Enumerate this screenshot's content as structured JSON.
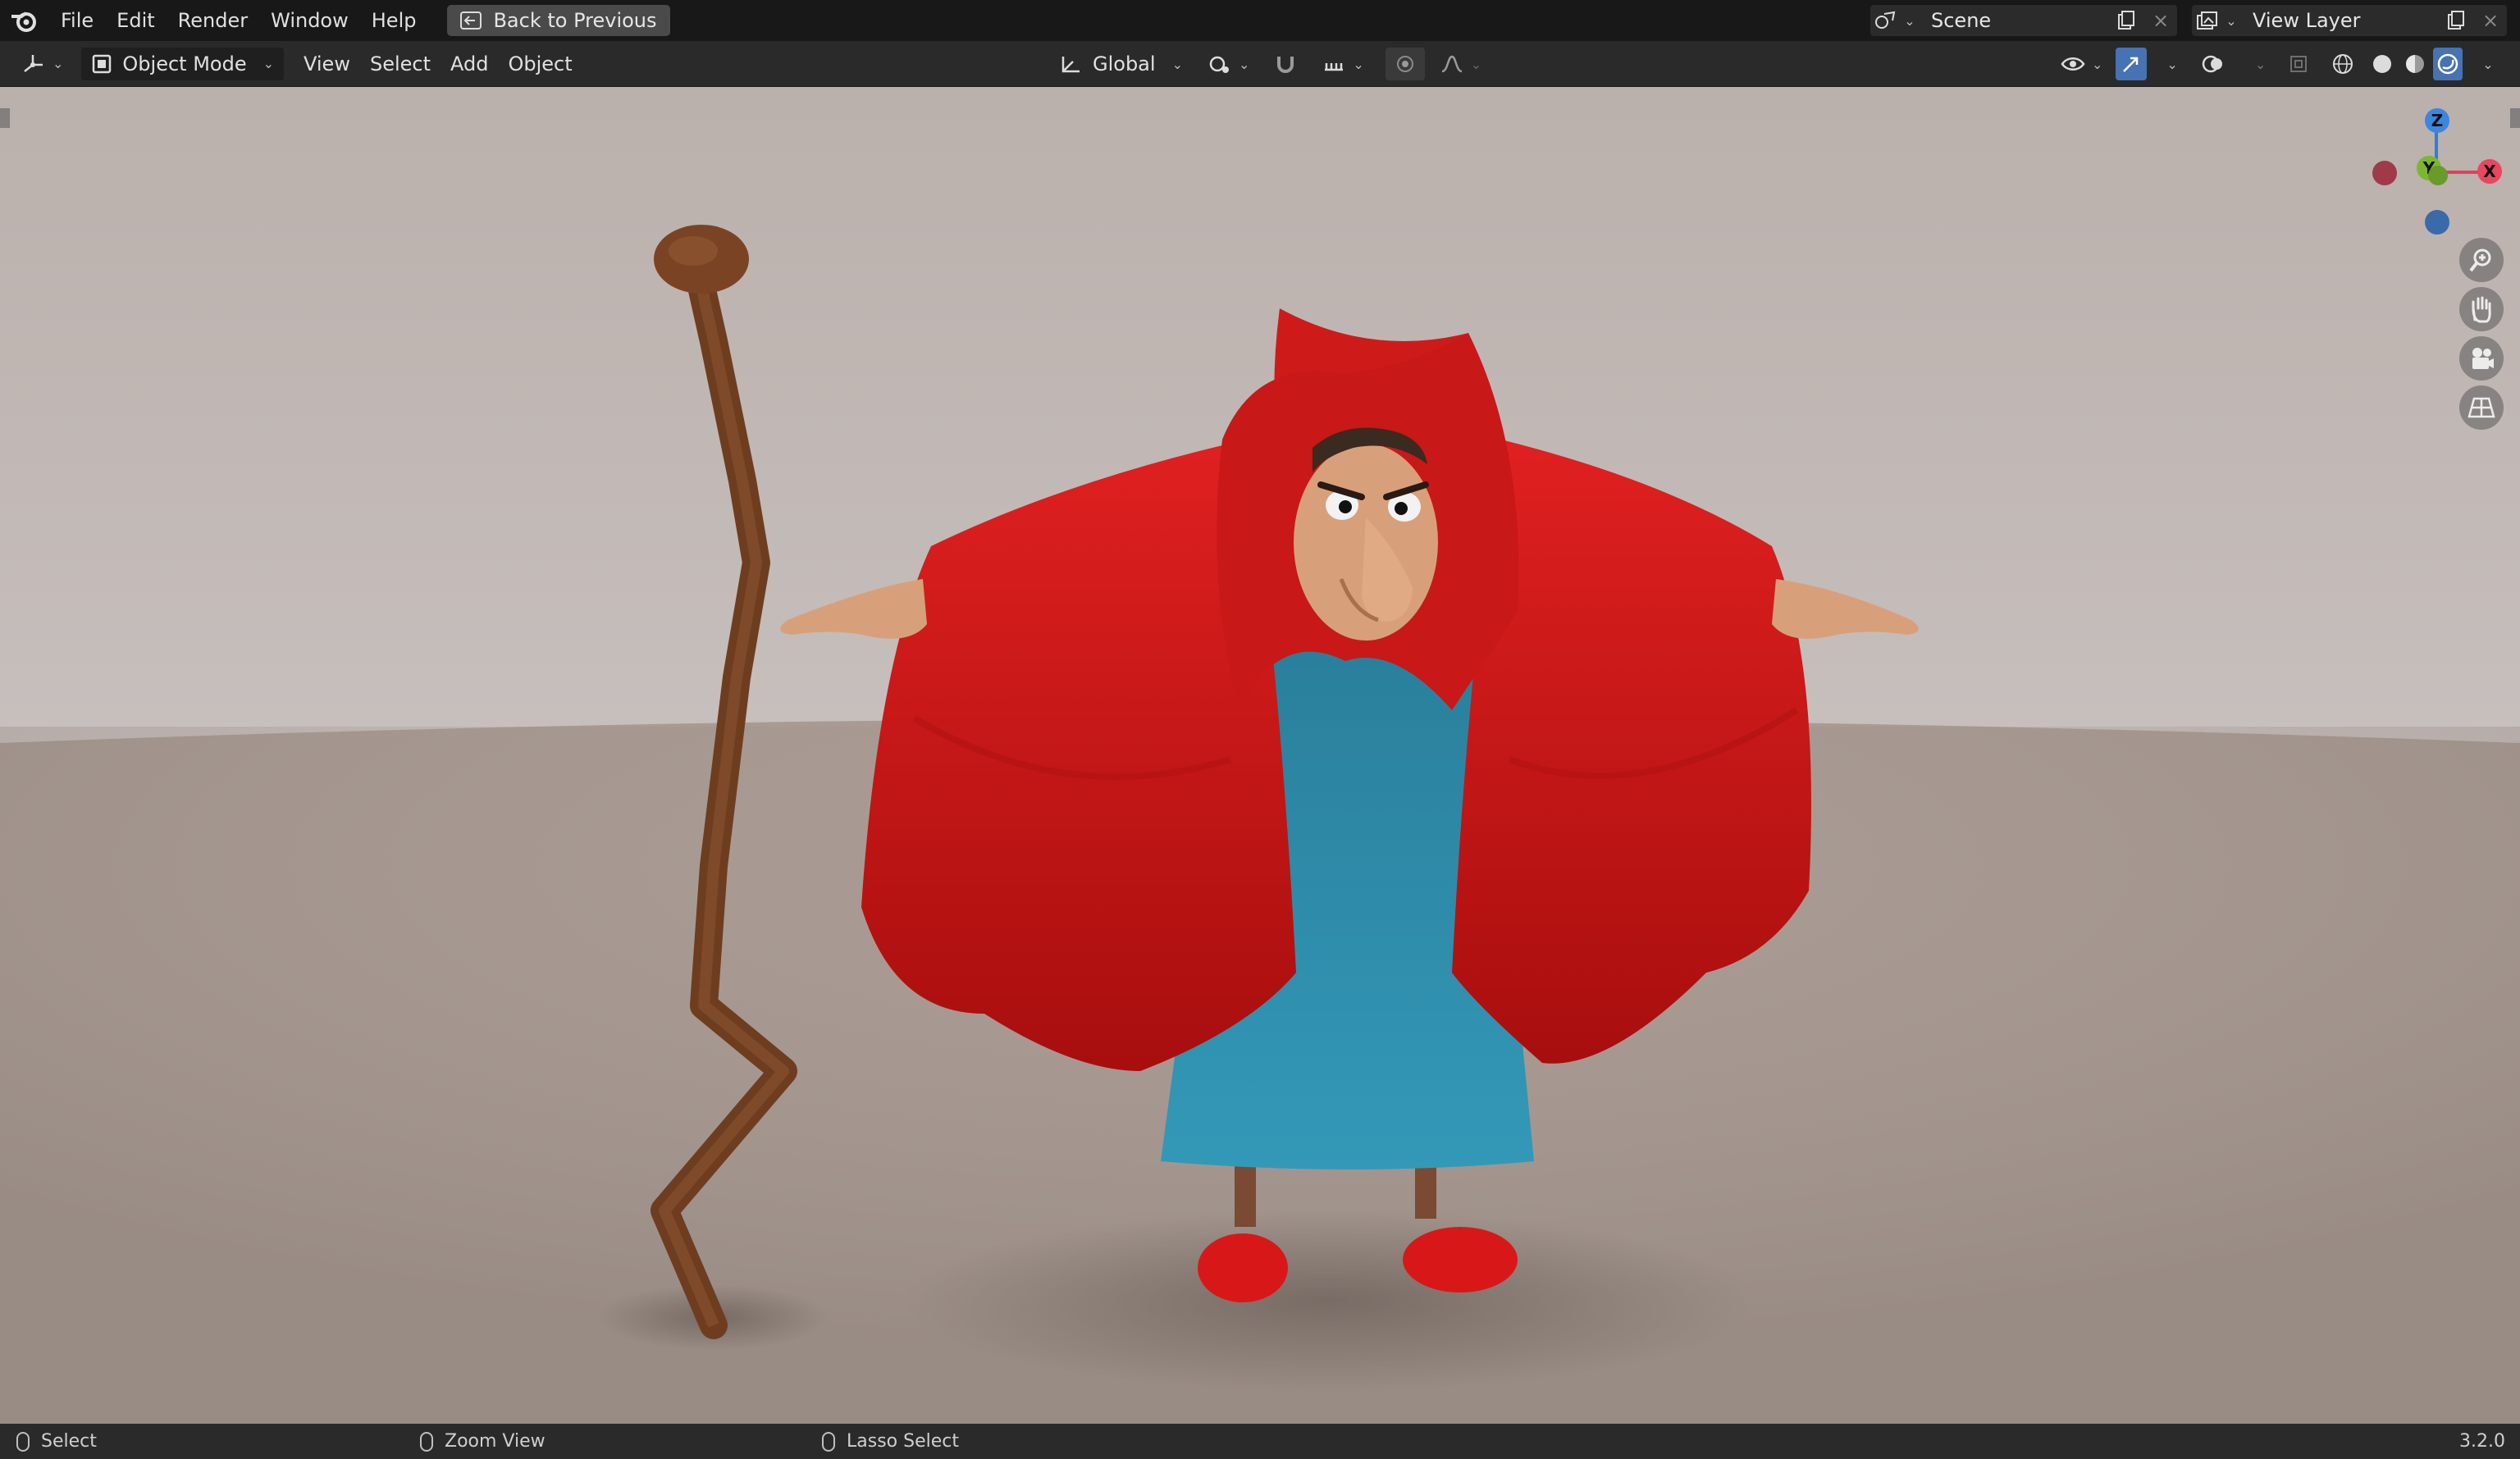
{
  "topbar": {
    "menu": [
      "File",
      "Edit",
      "Render",
      "Window",
      "Help"
    ],
    "back_button": "Back to Previous",
    "scene_label": "Scene",
    "view_layer_label": "View Layer"
  },
  "header": {
    "mode": "Object Mode",
    "menus": [
      "View",
      "Select",
      "Add",
      "Object"
    ],
    "transform_orientation": "Global"
  },
  "viewport": {
    "gizmo_axes": {
      "z": "Z",
      "y": "Y",
      "x": "X"
    }
  },
  "statusbar": {
    "left_action": "Select",
    "middle_action": "Zoom View",
    "right_action": "Lasso Select",
    "version": "3.2.0"
  },
  "colors": {
    "accent": "#4772b3",
    "cloak": "#d41a1a",
    "robe": "#2e8aa8",
    "staff": "#7a4424",
    "skin": "#d8a07a"
  }
}
